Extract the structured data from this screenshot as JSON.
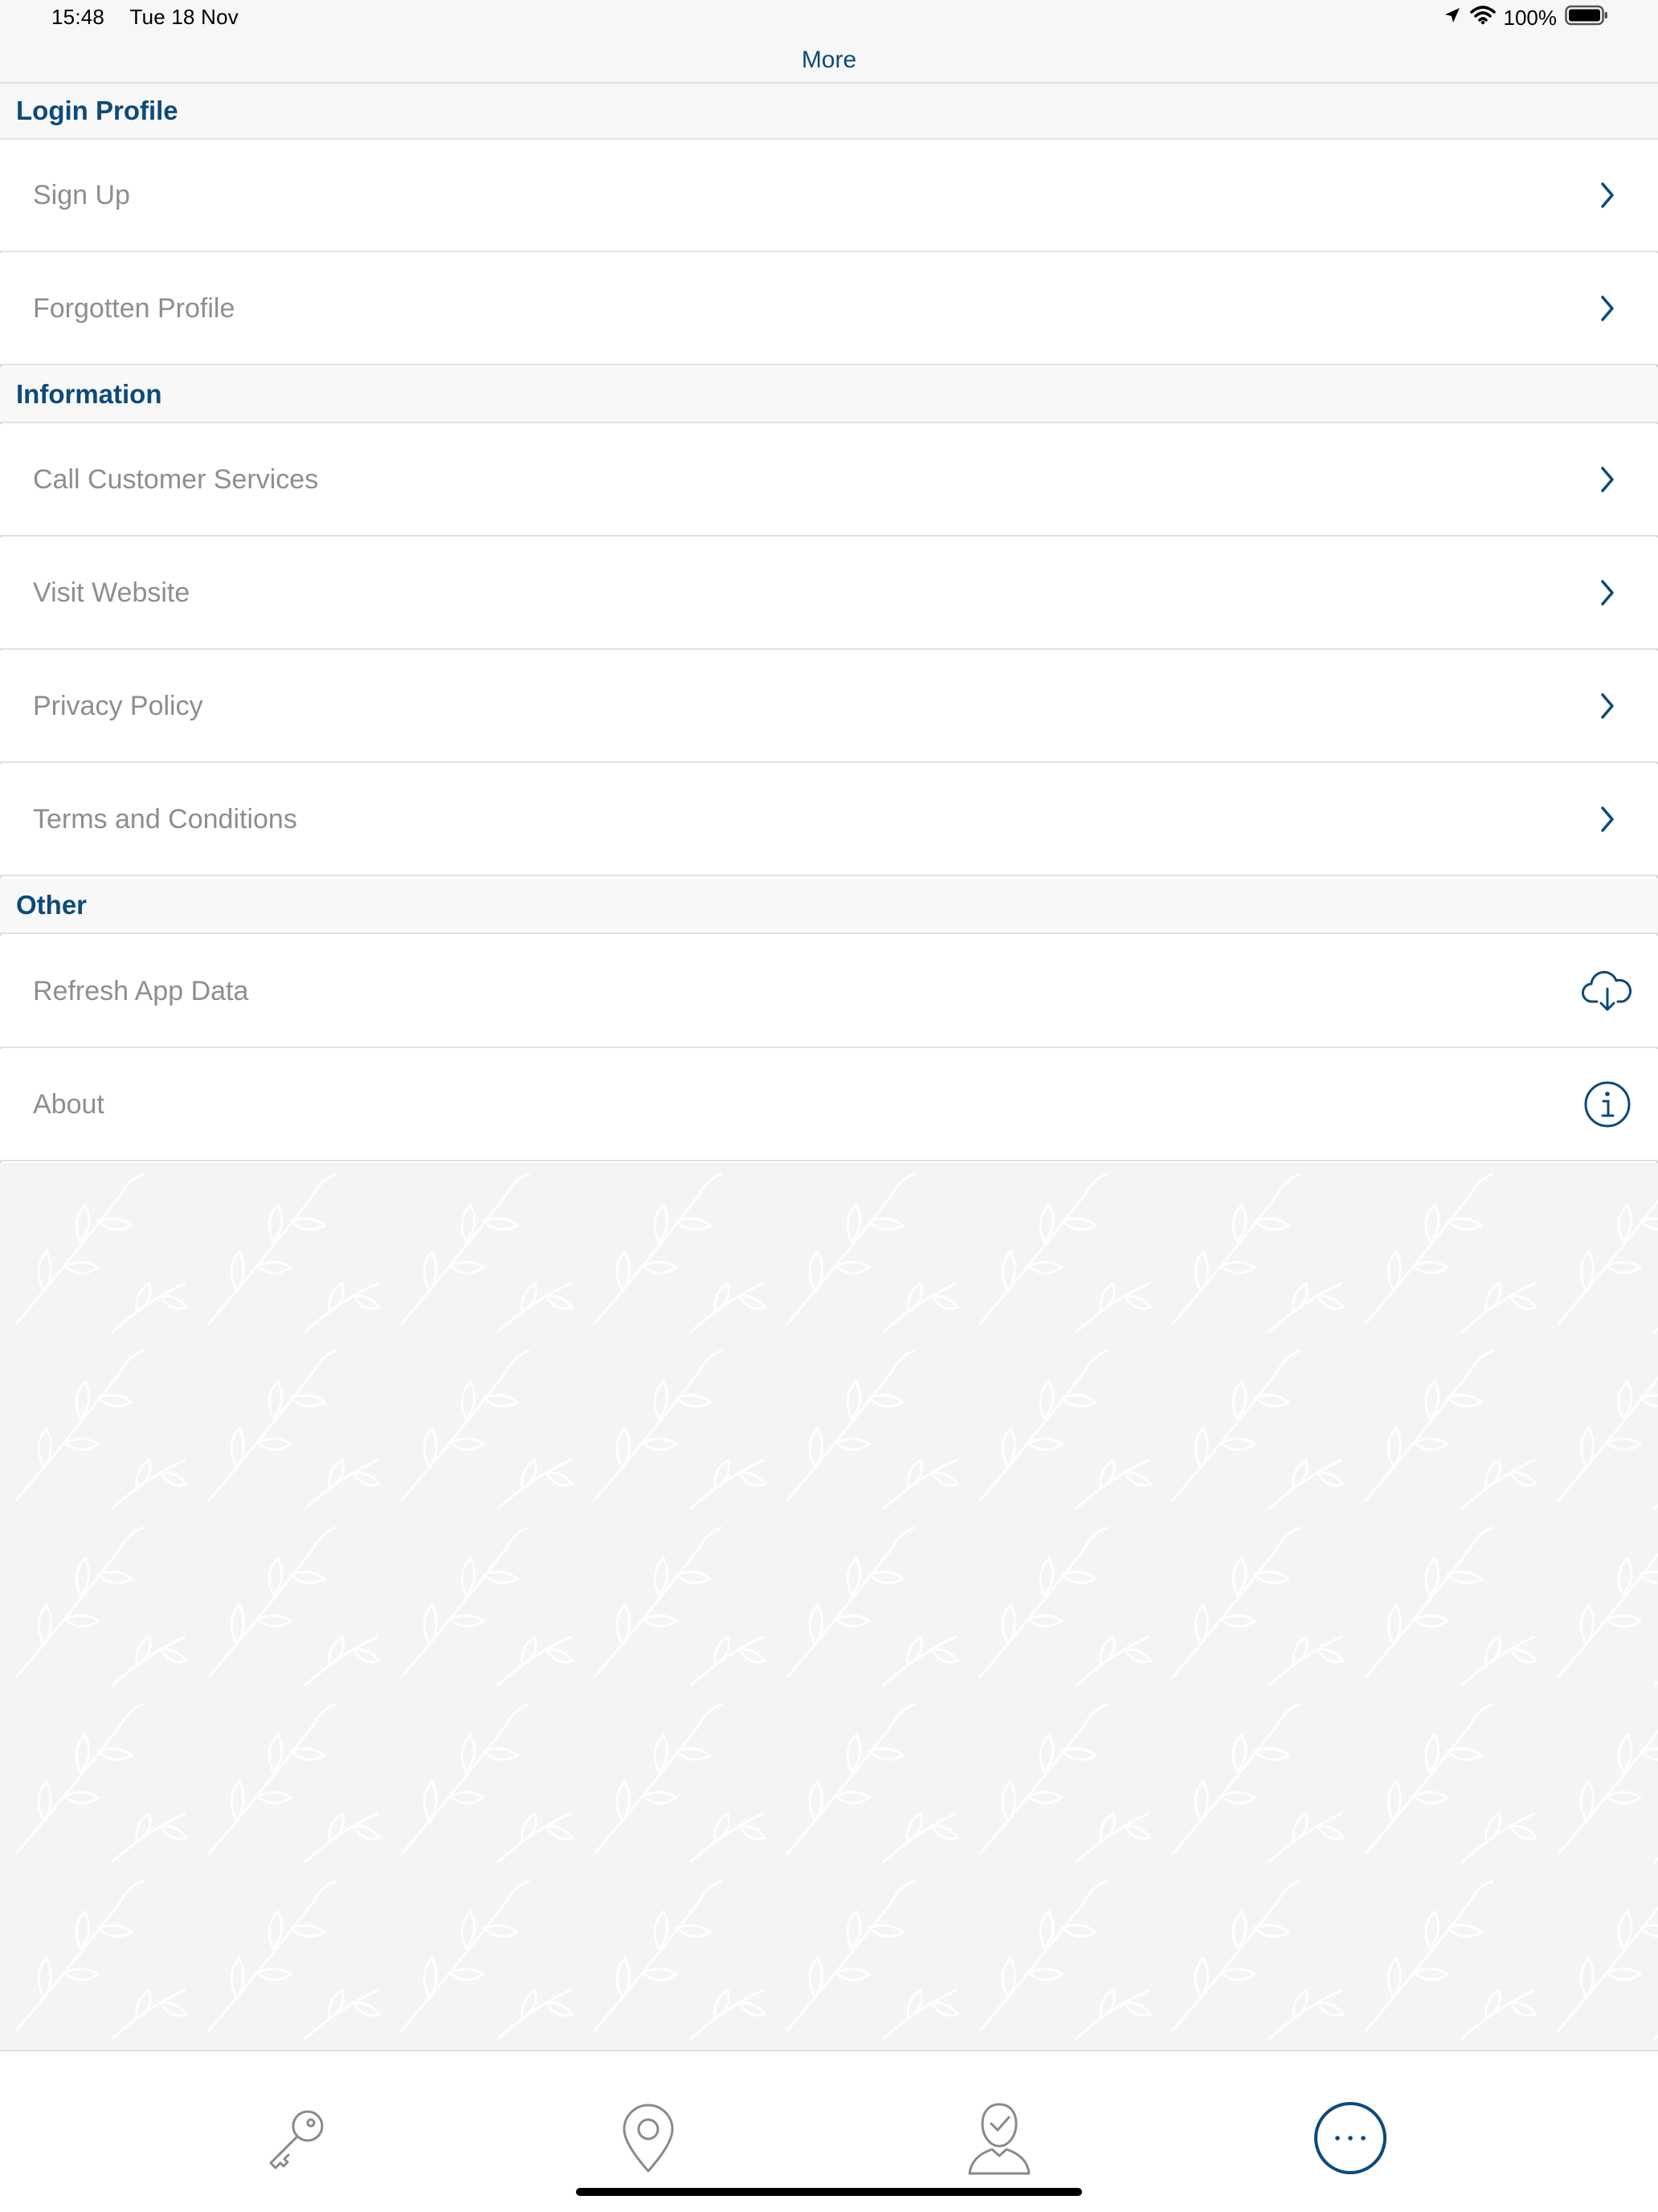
{
  "status_bar": {
    "time": "15:48",
    "date": "Tue 18 Nov",
    "battery": "100%",
    "icons": [
      "location-arrow-icon",
      "wifi-icon",
      "battery-icon"
    ]
  },
  "header": {
    "title": "More"
  },
  "sections": [
    {
      "title": "Login Profile",
      "items": [
        {
          "label": "Sign Up",
          "icon": "chevron-right-icon"
        },
        {
          "label": "Forgotten Profile",
          "icon": "chevron-right-icon"
        }
      ]
    },
    {
      "title": "Information",
      "items": [
        {
          "label": "Call Customer Services",
          "icon": "chevron-right-icon"
        },
        {
          "label": "Visit Website",
          "icon": "chevron-right-icon"
        },
        {
          "label": "Privacy Policy",
          "icon": "chevron-right-icon"
        },
        {
          "label": "Terms and Conditions",
          "icon": "chevron-right-icon"
        }
      ]
    },
    {
      "title": "Other",
      "items": [
        {
          "label": "Refresh App Data",
          "icon": "cloud-download-icon"
        },
        {
          "label": "About",
          "icon": "info-icon"
        }
      ]
    }
  ],
  "tab_bar": {
    "tabs": [
      {
        "icon": "key-icon",
        "selected": false
      },
      {
        "icon": "location-pin-icon",
        "selected": false
      },
      {
        "icon": "user-check-icon",
        "selected": false
      },
      {
        "icon": "more-icon",
        "selected": true
      }
    ]
  },
  "colors": {
    "accent": "#0d4a79",
    "label_text": "#8e8e8e",
    "inactive_icon": "#8a8a8a",
    "section_bg": "#f8f8f8",
    "pattern_bg": "#f4f4f4"
  }
}
